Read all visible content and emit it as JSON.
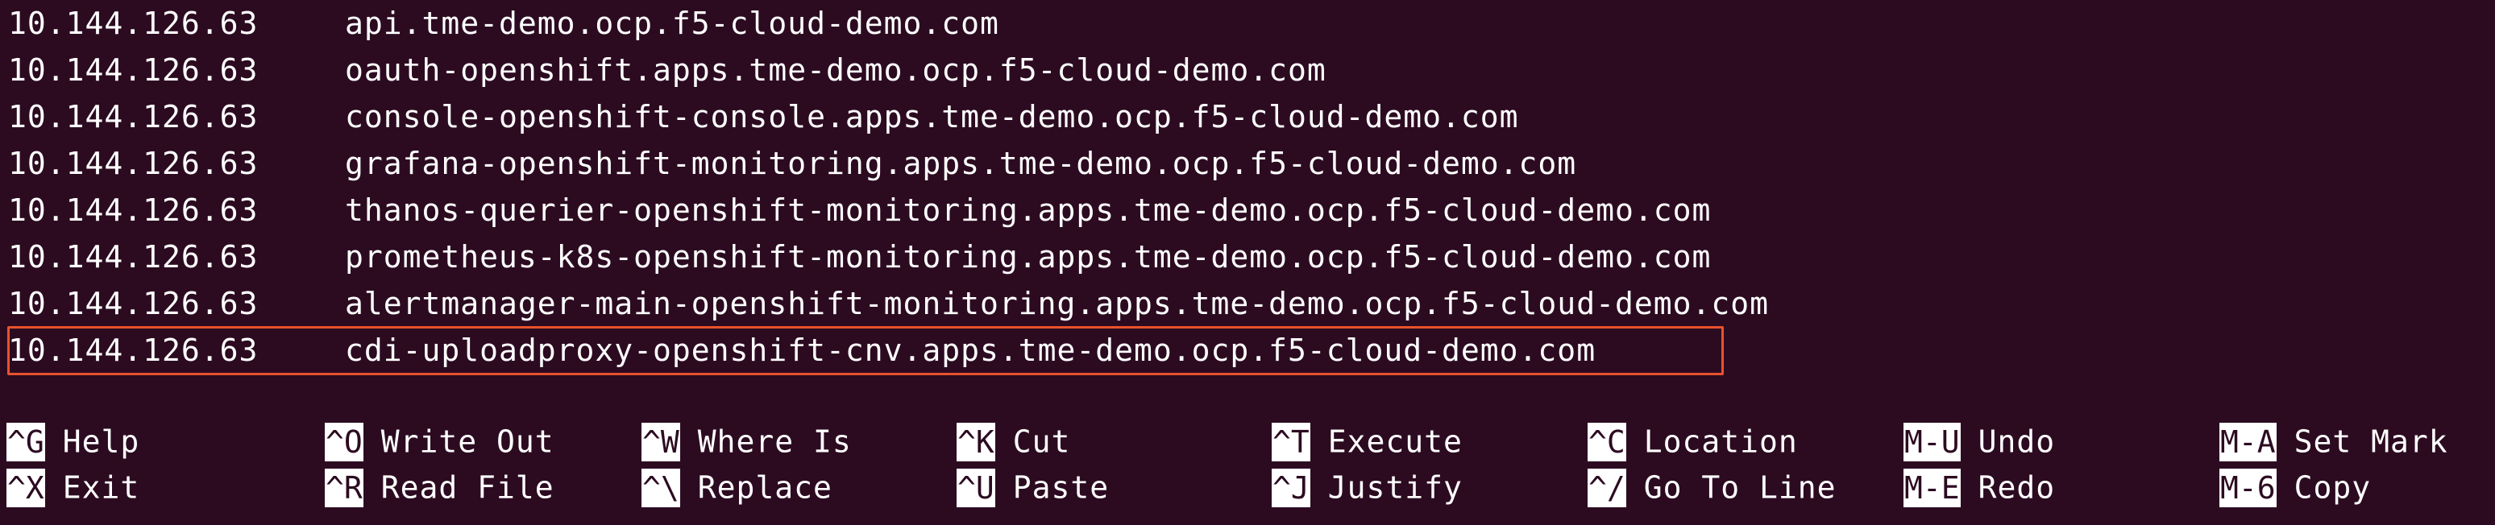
{
  "hosts": [
    {
      "ip": "10.144.126.63",
      "host": "api.tme-demo.ocp.f5-cloud-demo.com"
    },
    {
      "ip": "10.144.126.63",
      "host": "oauth-openshift.apps.tme-demo.ocp.f5-cloud-demo.com"
    },
    {
      "ip": "10.144.126.63",
      "host": "console-openshift-console.apps.tme-demo.ocp.f5-cloud-demo.com"
    },
    {
      "ip": "10.144.126.63",
      "host": "grafana-openshift-monitoring.apps.tme-demo.ocp.f5-cloud-demo.com"
    },
    {
      "ip": "10.144.126.63",
      "host": "thanos-querier-openshift-monitoring.apps.tme-demo.ocp.f5-cloud-demo.com"
    },
    {
      "ip": "10.144.126.63",
      "host": "prometheus-k8s-openshift-monitoring.apps.tme-demo.ocp.f5-cloud-demo.com"
    },
    {
      "ip": "10.144.126.63",
      "host": "alertmanager-main-openshift-monitoring.apps.tme-demo.ocp.f5-cloud-demo.com"
    },
    {
      "ip": "10.144.126.63",
      "host": "cdi-uploadproxy-openshift-cnv.apps.tme-demo.ocp.f5-cloud-demo.com"
    }
  ],
  "shortcuts": {
    "row1": [
      {
        "key": "^G",
        "label": "Help"
      },
      {
        "key": "^O",
        "label": "Write Out"
      },
      {
        "key": "^W",
        "label": "Where Is"
      },
      {
        "key": "^K",
        "label": "Cut"
      },
      {
        "key": "^T",
        "label": "Execute"
      },
      {
        "key": "^C",
        "label": "Location"
      },
      {
        "key": "M-U",
        "label": "Undo"
      },
      {
        "key": "M-A",
        "label": "Set Mark"
      }
    ],
    "row2": [
      {
        "key": "^X",
        "label": "Exit"
      },
      {
        "key": "^R",
        "label": "Read File"
      },
      {
        "key": "^\\",
        "label": "Replace"
      },
      {
        "key": "^U",
        "label": "Paste"
      },
      {
        "key": "^J",
        "label": "Justify"
      },
      {
        "key": "^/",
        "label": "Go To Line"
      },
      {
        "key": "M-E",
        "label": "Redo"
      },
      {
        "key": "M-6",
        "label": "Copy"
      }
    ]
  },
  "colors": {
    "background": "#2c0b21",
    "text": "#ffffff",
    "highlight_border": "#e8532d"
  }
}
